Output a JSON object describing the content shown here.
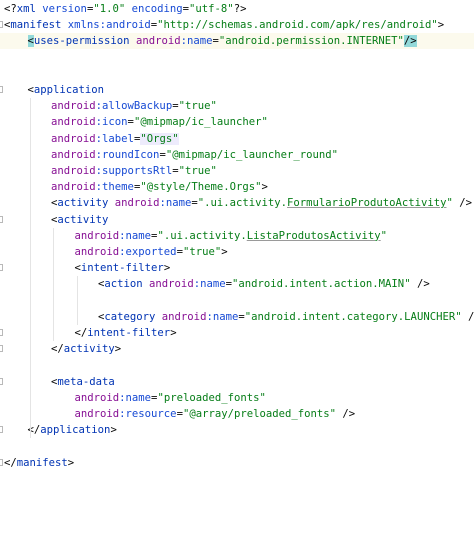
{
  "editor": {
    "lines": [
      {
        "indent": 0,
        "fold": false,
        "segments": [
          {
            "c": "pi",
            "t": "<?"
          },
          {
            "c": "tag",
            "t": "xml "
          },
          {
            "c": "attr",
            "t": "version"
          },
          {
            "c": "bracket",
            "t": "="
          },
          {
            "c": "val",
            "t": "\"1.0\""
          },
          {
            "c": "bracket",
            "t": " "
          },
          {
            "c": "attr",
            "t": "encoding"
          },
          {
            "c": "bracket",
            "t": "="
          },
          {
            "c": "val",
            "t": "\"utf-8\""
          },
          {
            "c": "pi",
            "t": "?>"
          }
        ]
      },
      {
        "indent": 0,
        "fold": true,
        "segments": [
          {
            "c": "bracket",
            "t": "<"
          },
          {
            "c": "tag",
            "t": "manifest "
          },
          {
            "c": "attr",
            "t": "xmlns:android"
          },
          {
            "c": "bracket",
            "t": "="
          },
          {
            "c": "val",
            "t": "\"http://schemas.android.com/apk/res/android\""
          },
          {
            "c": "bracket",
            "t": ">"
          }
        ]
      },
      {
        "indent": 1,
        "fold": false,
        "highlight": true,
        "segments": [
          {
            "c": "bracket match",
            "t": "<"
          },
          {
            "c": "tag",
            "t": "uses-permission "
          },
          {
            "c": "ns",
            "t": "android"
          },
          {
            "c": "attr",
            "t": ":name"
          },
          {
            "c": "bracket",
            "t": "="
          },
          {
            "c": "val",
            "t": "\"android.permission.INTERNET\""
          },
          {
            "c": "bracket match",
            "t": "/>"
          }
        ]
      },
      {
        "indent": 0,
        "fold": false,
        "segments": []
      },
      {
        "indent": 0,
        "fold": false,
        "segments": []
      },
      {
        "indent": 1,
        "fold": true,
        "segments": [
          {
            "c": "bracket",
            "t": "<"
          },
          {
            "c": "tag",
            "t": "application"
          }
        ]
      },
      {
        "indent": 2,
        "fold": false,
        "segments": [
          {
            "c": "ns",
            "t": "android"
          },
          {
            "c": "attr",
            "t": ":allowBackup"
          },
          {
            "c": "bracket",
            "t": "="
          },
          {
            "c": "val",
            "t": "\"true\""
          }
        ]
      },
      {
        "indent": 2,
        "fold": false,
        "segments": [
          {
            "c": "ns",
            "t": "android"
          },
          {
            "c": "attr",
            "t": ":icon"
          },
          {
            "c": "bracket",
            "t": "="
          },
          {
            "c": "val",
            "t": "\"@mipmap/ic_launcher\""
          }
        ]
      },
      {
        "indent": 2,
        "fold": false,
        "segments": [
          {
            "c": "ns",
            "t": "android"
          },
          {
            "c": "attr",
            "t": ":label"
          },
          {
            "c": "bracket",
            "t": "="
          },
          {
            "c": "val labelhl",
            "t": "\"Orgs\""
          }
        ]
      },
      {
        "indent": 2,
        "fold": false,
        "segments": [
          {
            "c": "ns",
            "t": "android"
          },
          {
            "c": "attr",
            "t": ":roundIcon"
          },
          {
            "c": "bracket",
            "t": "="
          },
          {
            "c": "val",
            "t": "\"@mipmap/ic_launcher_round\""
          }
        ]
      },
      {
        "indent": 2,
        "fold": false,
        "segments": [
          {
            "c": "ns",
            "t": "android"
          },
          {
            "c": "attr",
            "t": ":supportsRtl"
          },
          {
            "c": "bracket",
            "t": "="
          },
          {
            "c": "val",
            "t": "\"true\""
          }
        ]
      },
      {
        "indent": 2,
        "fold": false,
        "segments": [
          {
            "c": "ns",
            "t": "android"
          },
          {
            "c": "attr",
            "t": ":theme"
          },
          {
            "c": "bracket",
            "t": "="
          },
          {
            "c": "val",
            "t": "\"@style/Theme.Orgs\""
          },
          {
            "c": "bracket",
            "t": ">"
          }
        ]
      },
      {
        "indent": 2,
        "fold": false,
        "segments": [
          {
            "c": "bracket",
            "t": "<"
          },
          {
            "c": "tag",
            "t": "activity "
          },
          {
            "c": "ns",
            "t": "android"
          },
          {
            "c": "attr",
            "t": ":name"
          },
          {
            "c": "bracket",
            "t": "="
          },
          {
            "c": "val",
            "t": "\".ui.activity."
          },
          {
            "c": "val linkval",
            "t": "FormularioProdutoActivity"
          },
          {
            "c": "val",
            "t": "\""
          },
          {
            "c": "bracket",
            "t": " />"
          }
        ]
      },
      {
        "indent": 2,
        "fold": true,
        "segments": [
          {
            "c": "bracket",
            "t": "<"
          },
          {
            "c": "tag",
            "t": "activity"
          }
        ]
      },
      {
        "indent": 3,
        "fold": false,
        "segments": [
          {
            "c": "ns",
            "t": "android"
          },
          {
            "c": "attr",
            "t": ":name"
          },
          {
            "c": "bracket",
            "t": "="
          },
          {
            "c": "val",
            "t": "\".ui.activity."
          },
          {
            "c": "val linkval",
            "t": "ListaProdutosActivity"
          },
          {
            "c": "val",
            "t": "\""
          }
        ]
      },
      {
        "indent": 3,
        "fold": false,
        "segments": [
          {
            "c": "ns",
            "t": "android"
          },
          {
            "c": "attr",
            "t": ":exported"
          },
          {
            "c": "bracket",
            "t": "="
          },
          {
            "c": "val",
            "t": "\"true\""
          },
          {
            "c": "bracket",
            "t": ">"
          }
        ]
      },
      {
        "indent": 3,
        "fold": true,
        "segments": [
          {
            "c": "bracket",
            "t": "<"
          },
          {
            "c": "tag",
            "t": "intent-filter"
          },
          {
            "c": "bracket",
            "t": ">"
          }
        ]
      },
      {
        "indent": 4,
        "fold": false,
        "segments": [
          {
            "c": "bracket",
            "t": "<"
          },
          {
            "c": "tag",
            "t": "action "
          },
          {
            "c": "ns",
            "t": "android"
          },
          {
            "c": "attr",
            "t": ":name"
          },
          {
            "c": "bracket",
            "t": "="
          },
          {
            "c": "val",
            "t": "\"android.intent.action.MAIN\""
          },
          {
            "c": "bracket",
            "t": " />"
          }
        ]
      },
      {
        "indent": 0,
        "fold": false,
        "segments": []
      },
      {
        "indent": 4,
        "fold": false,
        "segments": [
          {
            "c": "bracket",
            "t": "<"
          },
          {
            "c": "tag",
            "t": "category "
          },
          {
            "c": "ns",
            "t": "android"
          },
          {
            "c": "attr",
            "t": ":name"
          },
          {
            "c": "bracket",
            "t": "="
          },
          {
            "c": "val",
            "t": "\"android.intent.category.LAUNCHER\""
          },
          {
            "c": "bracket",
            "t": " />"
          }
        ]
      },
      {
        "indent": 3,
        "fold": true,
        "segments": [
          {
            "c": "bracket",
            "t": "</"
          },
          {
            "c": "tag",
            "t": "intent-filter"
          },
          {
            "c": "bracket",
            "t": ">"
          }
        ]
      },
      {
        "indent": 2,
        "fold": true,
        "segments": [
          {
            "c": "bracket",
            "t": "</"
          },
          {
            "c": "tag",
            "t": "activity"
          },
          {
            "c": "bracket",
            "t": ">"
          }
        ]
      },
      {
        "indent": 0,
        "fold": false,
        "segments": []
      },
      {
        "indent": 2,
        "fold": true,
        "segments": [
          {
            "c": "bracket",
            "t": "<"
          },
          {
            "c": "tag",
            "t": "meta-data"
          }
        ]
      },
      {
        "indent": 3,
        "fold": false,
        "segments": [
          {
            "c": "ns",
            "t": "android"
          },
          {
            "c": "attr",
            "t": ":name"
          },
          {
            "c": "bracket",
            "t": "="
          },
          {
            "c": "val",
            "t": "\"preloaded_fonts\""
          }
        ]
      },
      {
        "indent": 3,
        "fold": false,
        "segments": [
          {
            "c": "ns",
            "t": "android"
          },
          {
            "c": "attr",
            "t": ":resource"
          },
          {
            "c": "bracket",
            "t": "="
          },
          {
            "c": "val",
            "t": "\"@array/preloaded_fonts\""
          },
          {
            "c": "bracket",
            "t": " />"
          }
        ]
      },
      {
        "indent": 1,
        "fold": true,
        "segments": [
          {
            "c": "bracket",
            "t": "</"
          },
          {
            "c": "tag",
            "t": "application"
          },
          {
            "c": "bracket",
            "t": ">"
          }
        ]
      },
      {
        "indent": 0,
        "fold": false,
        "segments": []
      },
      {
        "indent": 0,
        "fold": true,
        "segments": [
          {
            "c": "bracket",
            "t": "</"
          },
          {
            "c": "tag",
            "t": "manifest"
          },
          {
            "c": "bracket",
            "t": ">"
          }
        ]
      }
    ]
  },
  "colors": {
    "tag": "#0033b3",
    "attribute": "#174ad4",
    "namespace": "#871094",
    "value": "#067d17",
    "bracket_match": "#93d9d9",
    "current_line": "#fcfaed"
  }
}
